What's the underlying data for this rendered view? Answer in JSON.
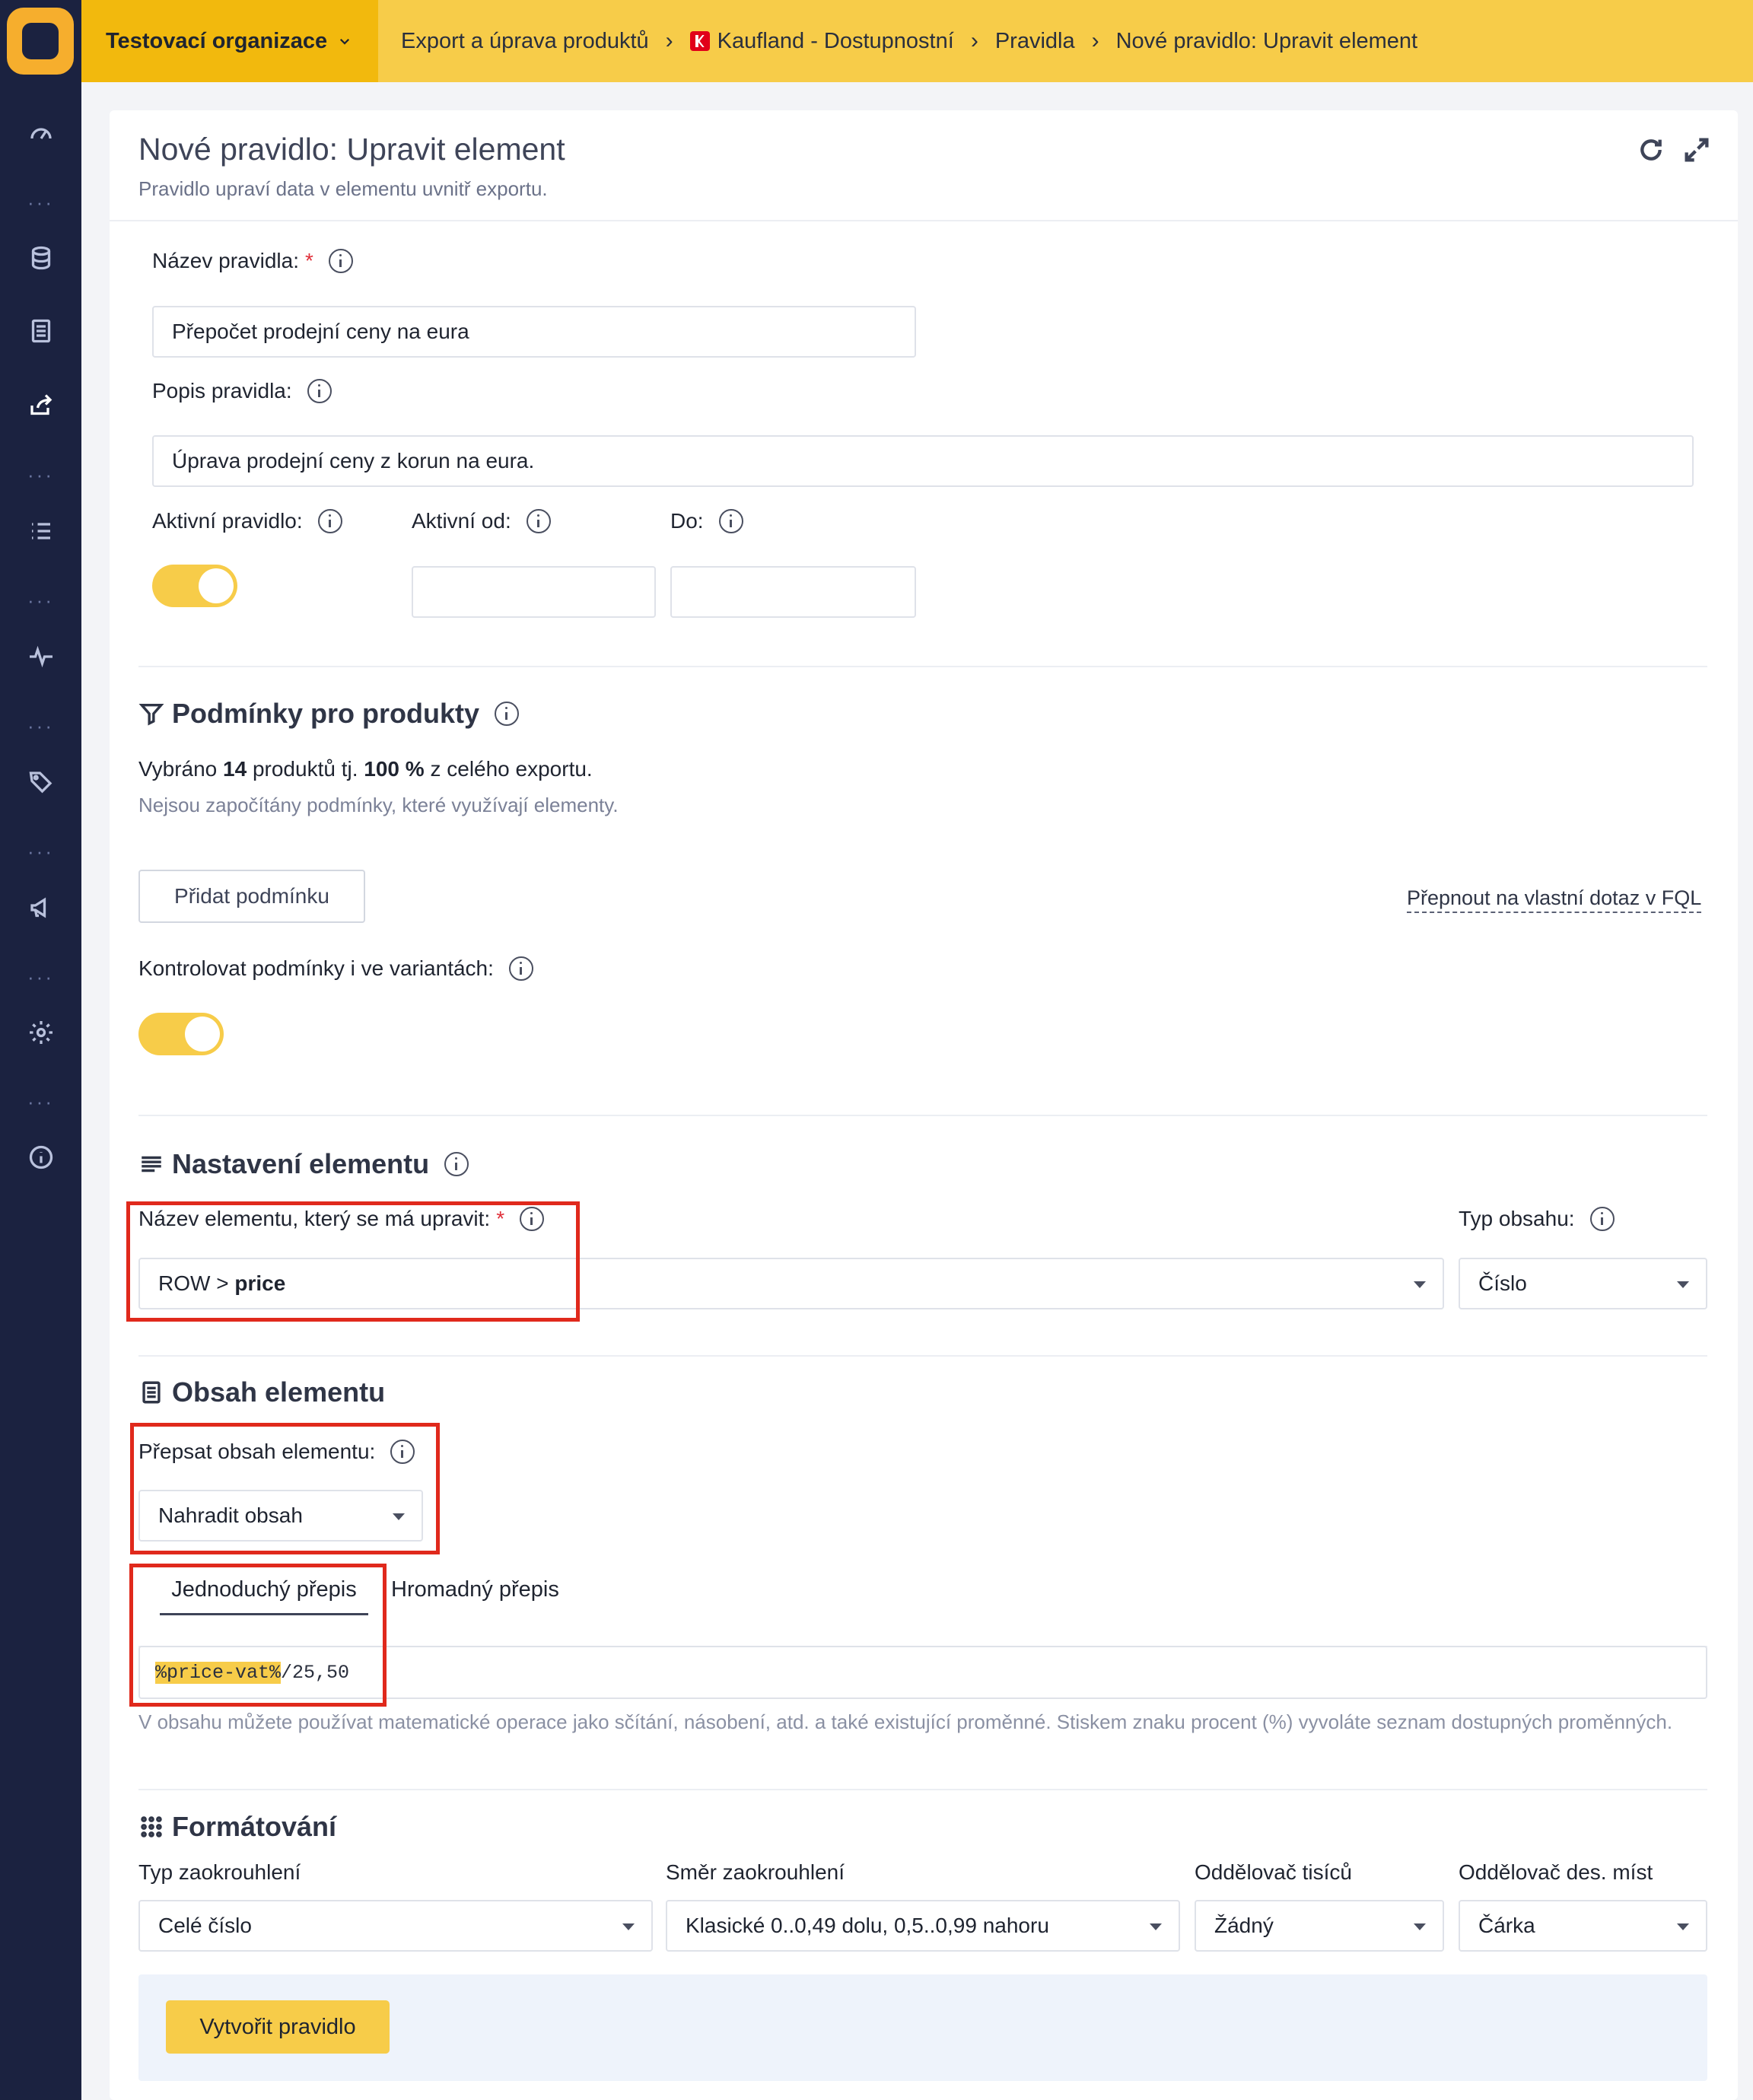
{
  "topbar": {
    "org": "Testovací organizace",
    "breadcrumbs": [
      {
        "label": "Export a úprava produktů"
      },
      {
        "label": "Kaufland - Dostupnostní"
      },
      {
        "label": "Pravidla"
      },
      {
        "label": "Nové pravidlo: Upravit element"
      }
    ]
  },
  "header": {
    "title": "Nové pravidlo: Upravit element",
    "subtitle": "Pravidlo upraví data v elementu uvnitř exportu."
  },
  "form": {
    "name_label": "Název pravidla:",
    "required_mark": "*",
    "name_value": "Přepočet prodejní ceny na eura",
    "desc_label": "Popis pravidla:",
    "desc_value": "Úprava prodejní ceny z korun na eura.",
    "active_label": "Aktivní pravidlo:",
    "active_on": true,
    "active_from_label": "Aktivní od:",
    "active_from_value": "",
    "active_to_label": "Do:",
    "active_to_value": ""
  },
  "conditions": {
    "title": "Podmínky pro produkty",
    "selected_prefix": "Vybráno ",
    "selected_count": "14",
    "selected_mid": " produktů tj. ",
    "selected_pct": "100 %",
    "selected_suffix": " z celého exportu.",
    "note": "Nejsou započítány podmínky, které využívají elementy.",
    "add_button": "Přidat podmínku",
    "fql_link": "Přepnout na vlastní dotaz v FQL",
    "variants_label": "Kontrolovat podmínky i ve variantách:",
    "variants_on": true
  },
  "element": {
    "title": "Nastavení elementu",
    "name_label": "Název elementu, který se má upravit:",
    "name_prefix": "ROW > ",
    "name_value": "price",
    "type_label": "Typ obsahu:",
    "type_value": "Číslo"
  },
  "content": {
    "title": "Obsah elementu",
    "overwrite_label": "Přepsat obsah elementu:",
    "overwrite_value": "Nahradit obsah",
    "tabs": [
      {
        "label": "Jednoduchý přepis",
        "active": true
      },
      {
        "label": "Hromadný přepis",
        "active": false
      }
    ],
    "expr_var": "%price-vat%",
    "expr_rest": "/25,50",
    "help": "V obsahu můžete používat matematické operace jako sčítání, násobení, atd. a také existující proměnné. Stiskem znaku procent (%) vyvoláte seznam dostupných proměnných."
  },
  "formatting": {
    "title": "Formátování",
    "rounding_type_label": "Typ zaokrouhlení",
    "rounding_type_value": "Celé číslo",
    "rounding_dir_label": "Směr zaokrouhlení",
    "rounding_dir_value": "Klasické 0..0,49 dolu, 0,5..0,99 nahoru",
    "thousands_label": "Oddělovač tisíců",
    "thousands_value": "Žádný",
    "decimal_label": "Oddělovač des. míst",
    "decimal_value": "Čárka"
  },
  "footer": {
    "create_button": "Vytvořit pravidlo"
  },
  "colors": {
    "accent": "#f7cc49",
    "sidebar": "#1b2240",
    "highlight_box": "#e0291c"
  }
}
